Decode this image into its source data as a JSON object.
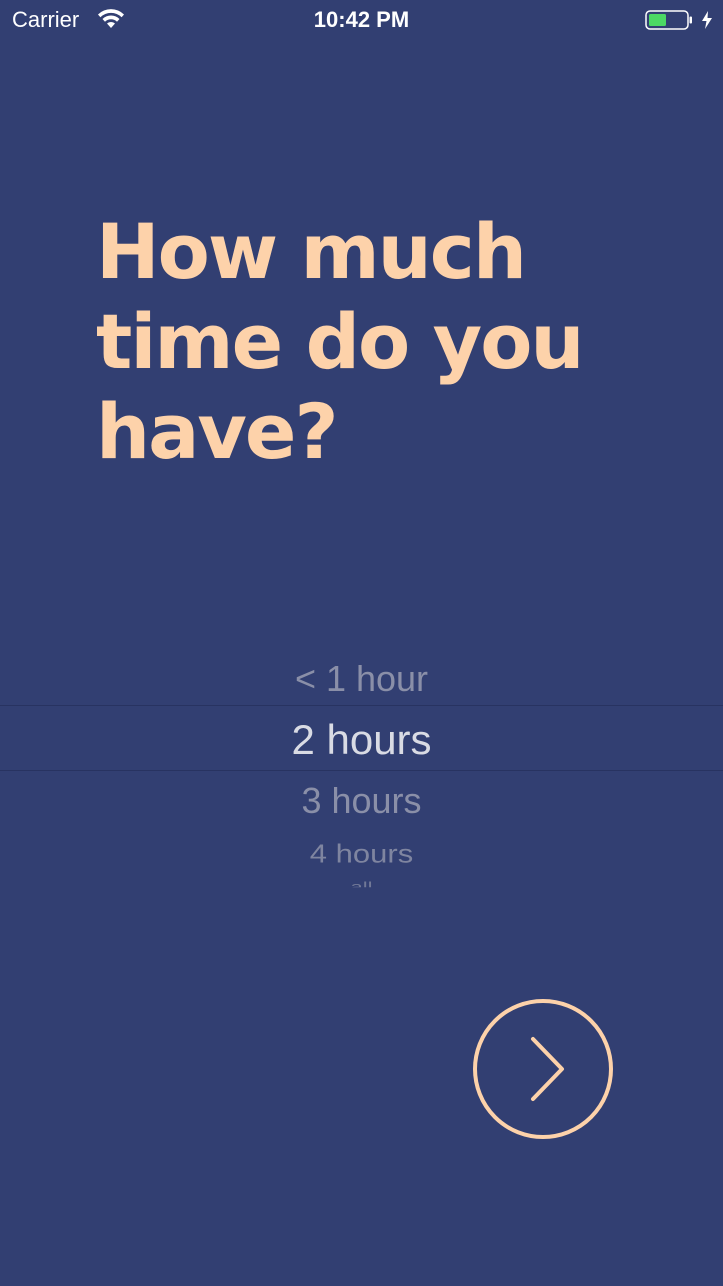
{
  "status_bar": {
    "carrier": "Carrier",
    "time": "10:42 PM",
    "battery_color": "#4cd964"
  },
  "question": {
    "text": "How much\ntime do you\nhave?"
  },
  "picker": {
    "options": [
      "< 1 hour",
      "2 hours",
      "3 hours",
      "4 hours",
      "all"
    ],
    "selected": "2 hours"
  },
  "next_button": {
    "icon": "chevron-right-icon"
  },
  "colors": {
    "background": "#323f72",
    "accent": "#fdd2aa",
    "selected_text": "#d9dbe4",
    "faded_text": "#8a8fa8"
  }
}
